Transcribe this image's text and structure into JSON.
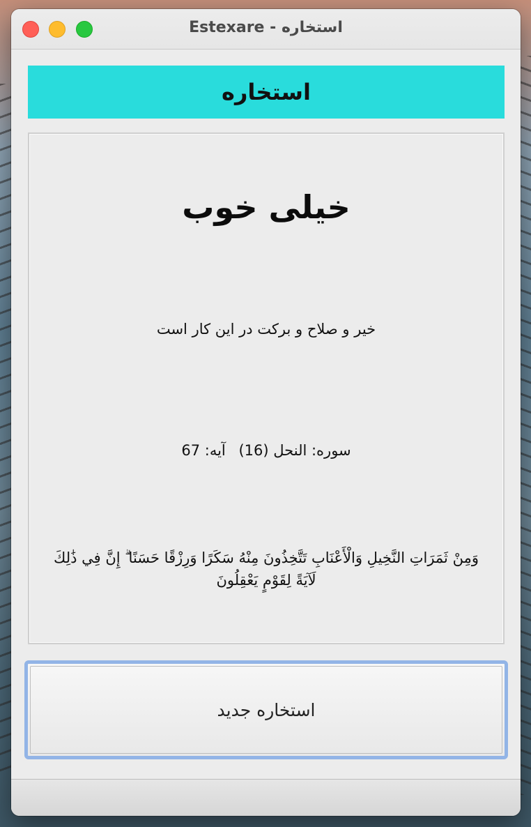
{
  "window": {
    "title": "Estexare - استخاره"
  },
  "header": {
    "label": "استخاره",
    "color": "#29dcdc"
  },
  "result": {
    "title": "خیلی خوب",
    "description": "خیر و صلاح و برکت در این کار است",
    "surah_label": "سوره: النحل (16)",
    "ayah_label": "آیه: 67",
    "verse": "وَمِنْ ثَمَرَاتِ النَّخِيلِ وَالْأَعْنَابِ تَتَّخِذُونَ مِنْهُ سَكَرًا وَرِزْقًا حَسَنًا ۗ إِنَّ فِي ذَٰلِكَ لَآيَةً لِقَوْمٍ يَعْقِلُونَ"
  },
  "actions": {
    "new_estekhare_label": "استخاره جدید",
    "focus_ring_color": "#92b4e6"
  }
}
